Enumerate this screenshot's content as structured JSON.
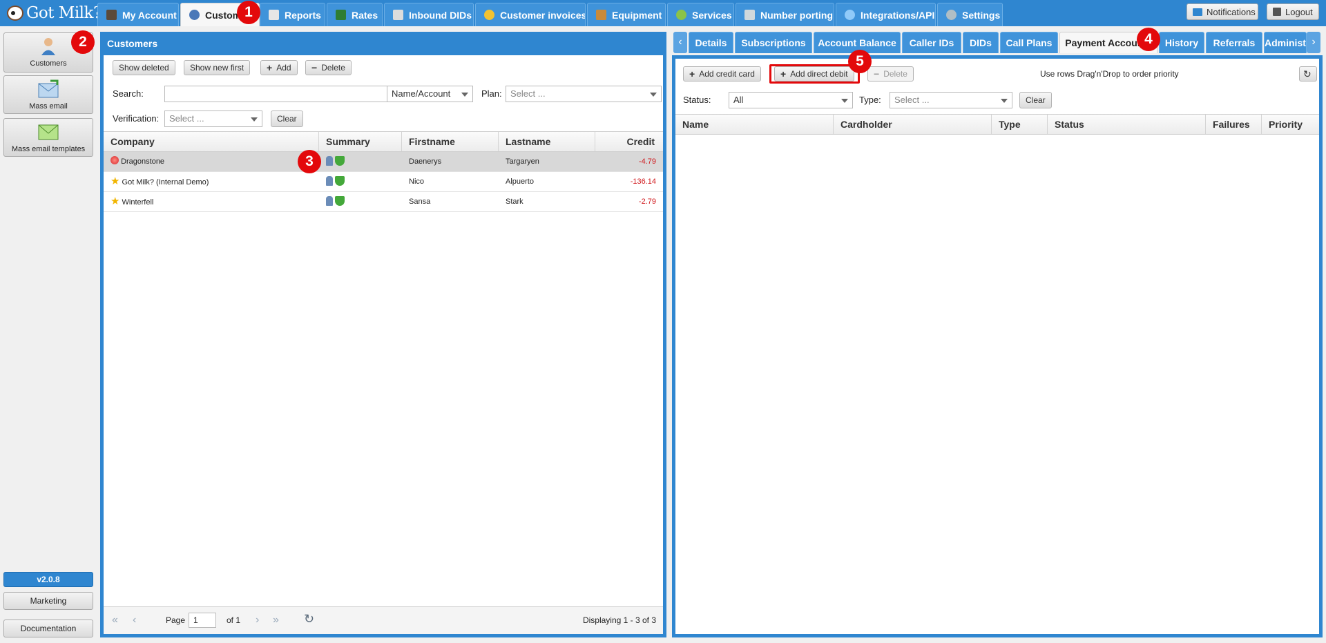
{
  "app": {
    "logo_text": "Got Milk?"
  },
  "top_tabs": [
    {
      "label": "My Account",
      "icon": "user-lock-icon"
    },
    {
      "label": "Customers",
      "icon": "user-icon"
    },
    {
      "label": "Reports",
      "icon": "report-icon"
    },
    {
      "label": "Rates",
      "icon": "rates-icon"
    },
    {
      "label": "Inbound DIDs",
      "icon": "list-icon"
    },
    {
      "label": "Customer invoices",
      "icon": "coins-icon"
    },
    {
      "label": "Equipment",
      "icon": "box-icon"
    },
    {
      "label": "Services",
      "icon": "refresh-icon"
    },
    {
      "label": "Number porting",
      "icon": "phone-icon"
    },
    {
      "label": "Integrations/API",
      "icon": "gear-ring-icon"
    },
    {
      "label": "Settings",
      "icon": "settings-icon"
    }
  ],
  "top_right": {
    "notifications": "Notifications",
    "logout": "Logout"
  },
  "sidebar": {
    "items": [
      {
        "label": "Customers",
        "icon": "customer-icon"
      },
      {
        "label": "Mass email",
        "icon": "mass-email-icon"
      },
      {
        "label": "Mass email templates",
        "icon": "email-template-icon"
      }
    ],
    "version": "v2.0.8",
    "marketing": "Marketing",
    "documentation": "Documentation"
  },
  "customers_panel": {
    "title": "Customers",
    "toolbar": {
      "show_deleted": "Show deleted",
      "show_new_first": "Show new first",
      "add": "Add",
      "delete": "Delete"
    },
    "search_label": "Search:",
    "search_value": "",
    "search_mode": "Name/Account",
    "plan_label": "Plan:",
    "plan_placeholder": "Select ...",
    "verification_label": "Verification:",
    "verification_placeholder": "Select ...",
    "clear": "Clear",
    "columns": [
      "Company",
      "Summary",
      "Firstname",
      "Lastname",
      "Credit"
    ],
    "rows": [
      {
        "company": "Dragonstone",
        "firstname": "Daenerys",
        "lastname": "Targaryen",
        "credit": "-4.79",
        "status": "red-dot"
      },
      {
        "company": "Got Milk? (Internal Demo)",
        "firstname": "Nico",
        "lastname": "Alpuerto",
        "credit": "-136.14",
        "status": "star"
      },
      {
        "company": "Winterfell",
        "firstname": "Sansa",
        "lastname": "Stark",
        "credit": "-2.79",
        "status": "star"
      }
    ],
    "pager": {
      "page_label": "Page",
      "page_value": "1",
      "of_label": "of 1",
      "displaying": "Displaying 1 - 3 of 3"
    }
  },
  "detail_tabs": [
    "Details",
    "Subscriptions",
    "Account Balance",
    "Caller IDs",
    "DIDs",
    "Call Plans",
    "Payment Accounts",
    "History",
    "Referrals",
    "Administration"
  ],
  "payment_panel": {
    "toolbar": {
      "add_credit_card": "Add credit card",
      "add_direct_debit": "Add direct debit",
      "delete": "Delete",
      "hint": "Use rows Drag'n'Drop to order priority"
    },
    "status_label": "Status:",
    "status_value": "All",
    "type_label": "Type:",
    "type_placeholder": "Select ...",
    "clear": "Clear",
    "columns": [
      "Name",
      "Cardholder",
      "Type",
      "Status",
      "Failures",
      "Priority"
    ]
  },
  "markers": [
    "1",
    "2",
    "3",
    "4",
    "5"
  ],
  "colors": {
    "brand": "#2f86d0",
    "marker": "#e3090b",
    "negative_credit": "#d0171b"
  }
}
